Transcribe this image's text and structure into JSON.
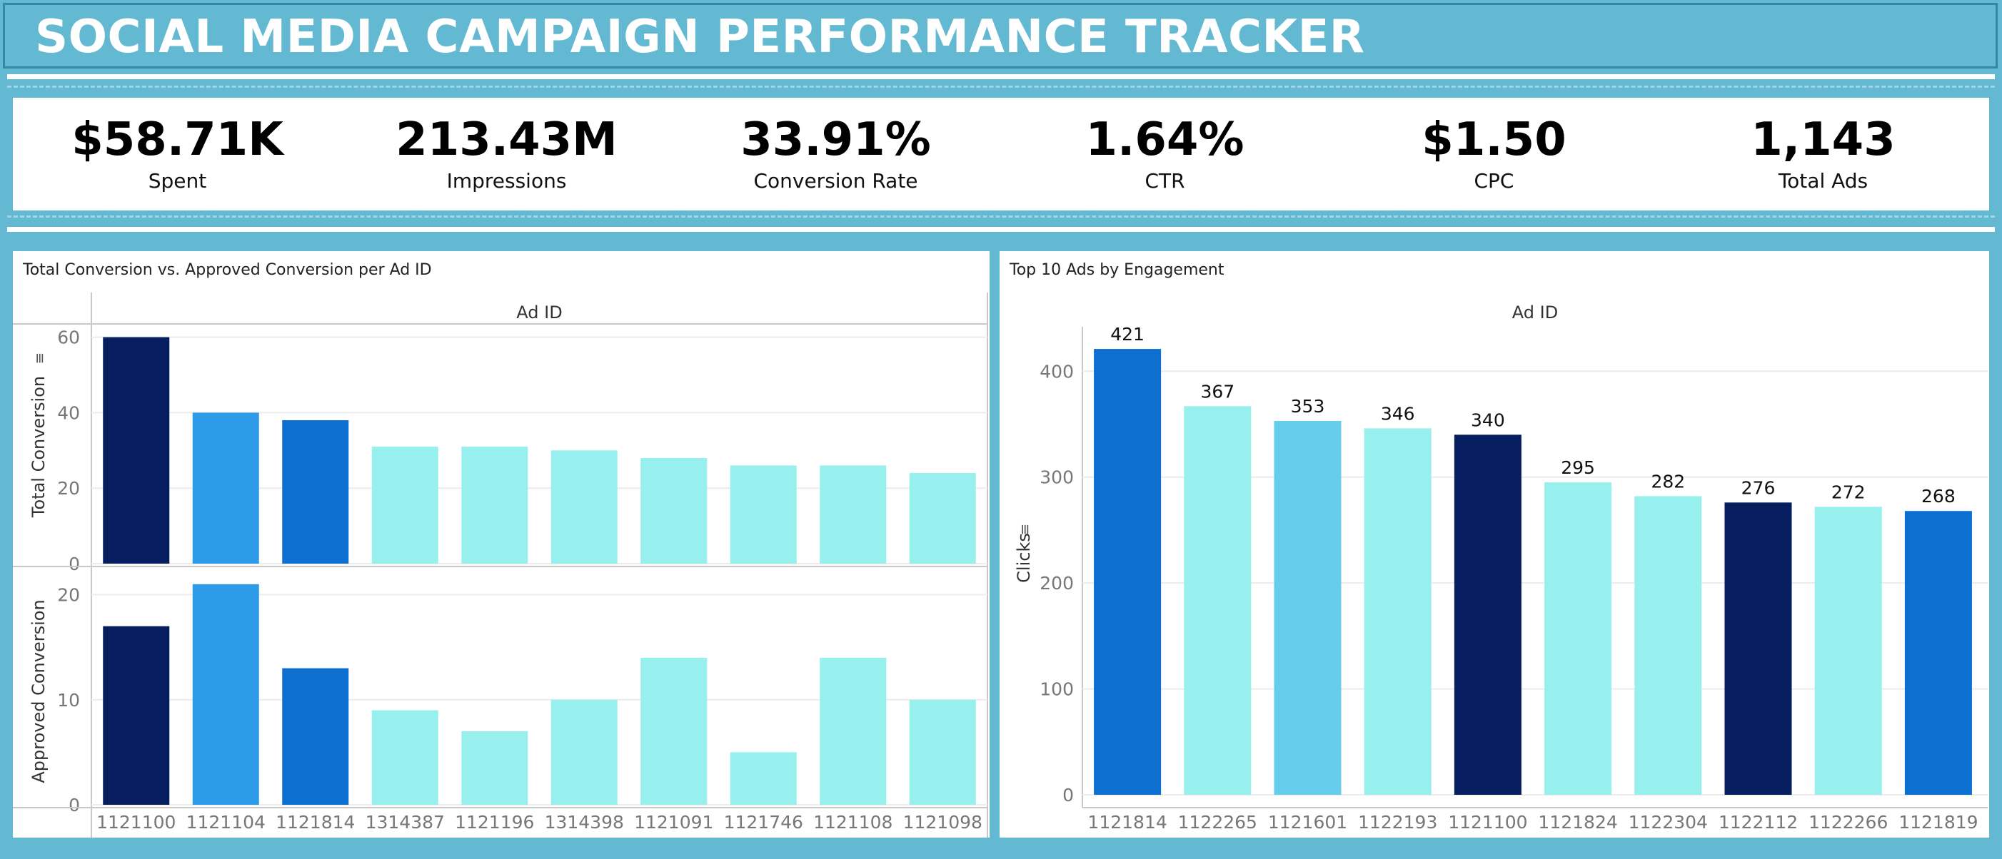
{
  "header": {
    "title": "SOCIAL MEDIA CAMPAIGN PERFORMANCE TRACKER"
  },
  "kpis": [
    {
      "value": "$58.71K",
      "label": "Spent"
    },
    {
      "value": "213.43M",
      "label": "Impressions"
    },
    {
      "value": "33.91%",
      "label": "Conversion Rate"
    },
    {
      "value": "1.64%",
      "label": "CTR"
    },
    {
      "value": "$1.50",
      "label": "CPC"
    },
    {
      "value": "1,143",
      "label": "Total Ads"
    }
  ],
  "colors": {
    "background": "#63b9d2",
    "navy": "#061e5f",
    "blue": "#0d6fcf",
    "bright_blue": "#2e9be8",
    "sky": "#66cdec",
    "aqua": "#98f0ee"
  },
  "chart_data": [
    {
      "type": "bar",
      "title": "Total Conversion vs. Approved Conversion per Ad ID",
      "xlabel": "Ad ID",
      "categories": [
        "1121100",
        "1121104",
        "1121814",
        "1314387",
        "1121196",
        "1314398",
        "1121091",
        "1121746",
        "1121108",
        "1121098"
      ],
      "bar_colors": [
        "#061e5f",
        "#2e9be8",
        "#0d6fcf",
        "#98f0ee",
        "#98f0ee",
        "#98f0ee",
        "#98f0ee",
        "#98f0ee",
        "#98f0ee",
        "#98f0ee"
      ],
      "series": [
        {
          "name": "Total Conversion",
          "values": [
            60,
            40,
            38,
            31,
            31,
            30,
            28,
            26,
            26,
            24
          ],
          "ylim": [
            0,
            62
          ],
          "ticks": [
            0,
            20,
            40,
            60
          ]
        },
        {
          "name": "Approved Conversion",
          "values": [
            17,
            21,
            13,
            9,
            7,
            10,
            14,
            5,
            14,
            10
          ],
          "ylim": [
            0,
            21.6
          ],
          "ticks": [
            0,
            10,
            20
          ]
        }
      ],
      "grid": true,
      "legend": "none"
    },
    {
      "type": "bar",
      "title": "Top 10 Ads by Engagement",
      "xlabel": "Ad ID",
      "ylabel": "Clicks",
      "categories": [
        "1121814",
        "1122265",
        "1121601",
        "1122193",
        "1121100",
        "1121824",
        "1122304",
        "1122112",
        "1122266",
        "1121819"
      ],
      "values": [
        421,
        367,
        353,
        346,
        340,
        295,
        282,
        276,
        272,
        268
      ],
      "data_labels": [
        "421",
        "367",
        "353",
        "346",
        "340",
        "295",
        "282",
        "276",
        "272",
        "268"
      ],
      "bar_colors": [
        "#0d6fcf",
        "#98f0ee",
        "#66cdec",
        "#98f0ee",
        "#061e5f",
        "#98f0ee",
        "#98f0ee",
        "#061e5f",
        "#98f0ee",
        "#0d6fcf"
      ],
      "ylim": [
        0,
        446
      ],
      "ticks": [
        0,
        100,
        200,
        300,
        400
      ],
      "grid": true,
      "legend": "none"
    }
  ]
}
